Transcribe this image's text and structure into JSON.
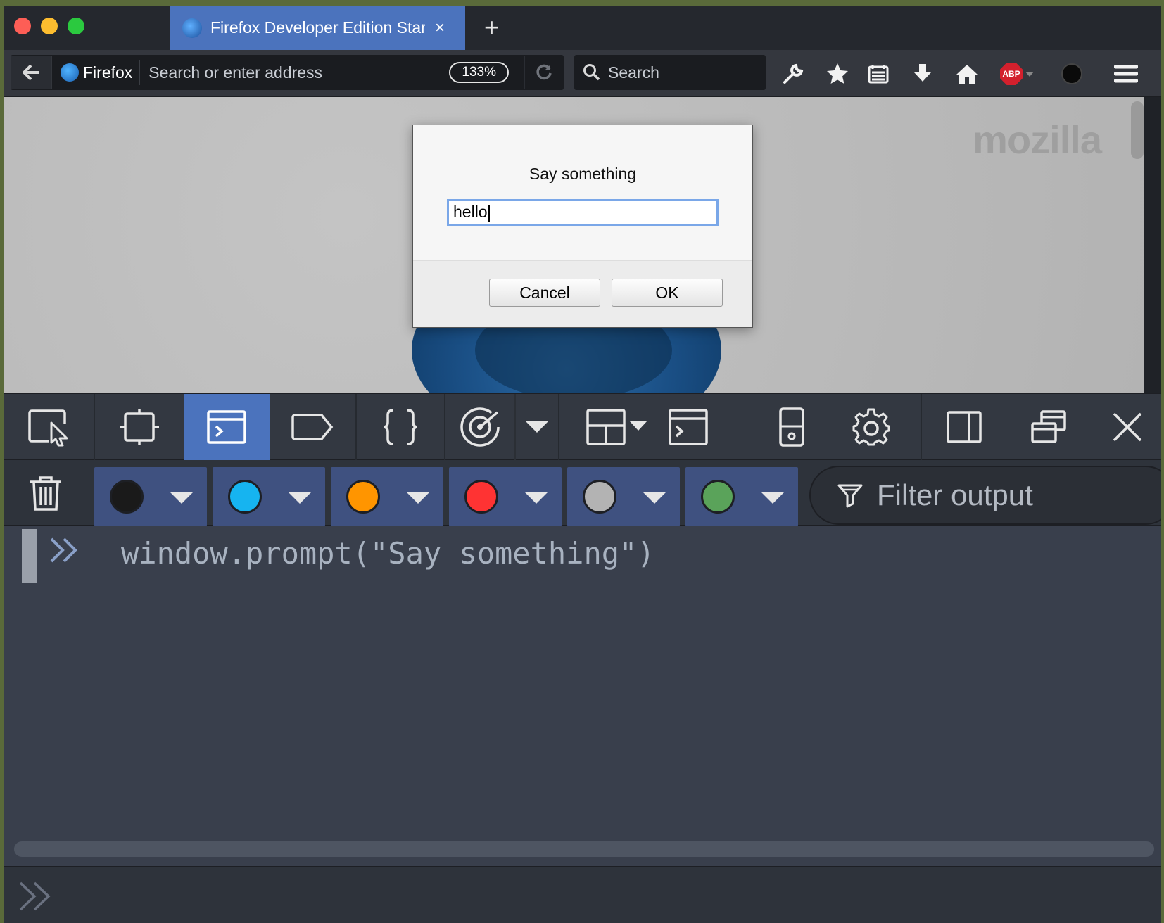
{
  "browser": {
    "tab": {
      "title": "Firefox Developer Edition Star",
      "close": "×"
    },
    "new_tab": "+",
    "urlbar": {
      "brand": "Firefox",
      "placeholder": "Search or enter address",
      "zoom": "133%"
    },
    "searchbar": {
      "placeholder": "Search"
    },
    "toolbar_icons": [
      "wrench-icon",
      "star-icon",
      "reading-list-icon",
      "download-icon",
      "home-icon",
      "abp-icon",
      "youtube-icon",
      "menu-icon"
    ],
    "abp_label": "ABP"
  },
  "page": {
    "watermark": "mozilla"
  },
  "dialog": {
    "message": "Say something",
    "input_value": "hello",
    "cancel": "Cancel",
    "ok": "OK"
  },
  "devtools": {
    "tools": [
      "inspector",
      "responsive",
      "console",
      "tag",
      "debugger",
      "performance",
      "layout",
      "scratchpad",
      "device",
      "settings",
      "dock-side",
      "undock",
      "close"
    ],
    "active_tool": "console",
    "filters": [
      {
        "name": "black",
        "color": "#1a1a1a"
      },
      {
        "name": "blue",
        "color": "#16b4f0"
      },
      {
        "name": "orange",
        "color": "#ff9500"
      },
      {
        "name": "red",
        "color": "#ff3333"
      },
      {
        "name": "gray",
        "color": "#b3b3b3"
      },
      {
        "name": "green",
        "color": "#5aa35a"
      }
    ],
    "filter_placeholder": "Filter output",
    "console_command": "window.prompt(\"Say something\")"
  }
}
